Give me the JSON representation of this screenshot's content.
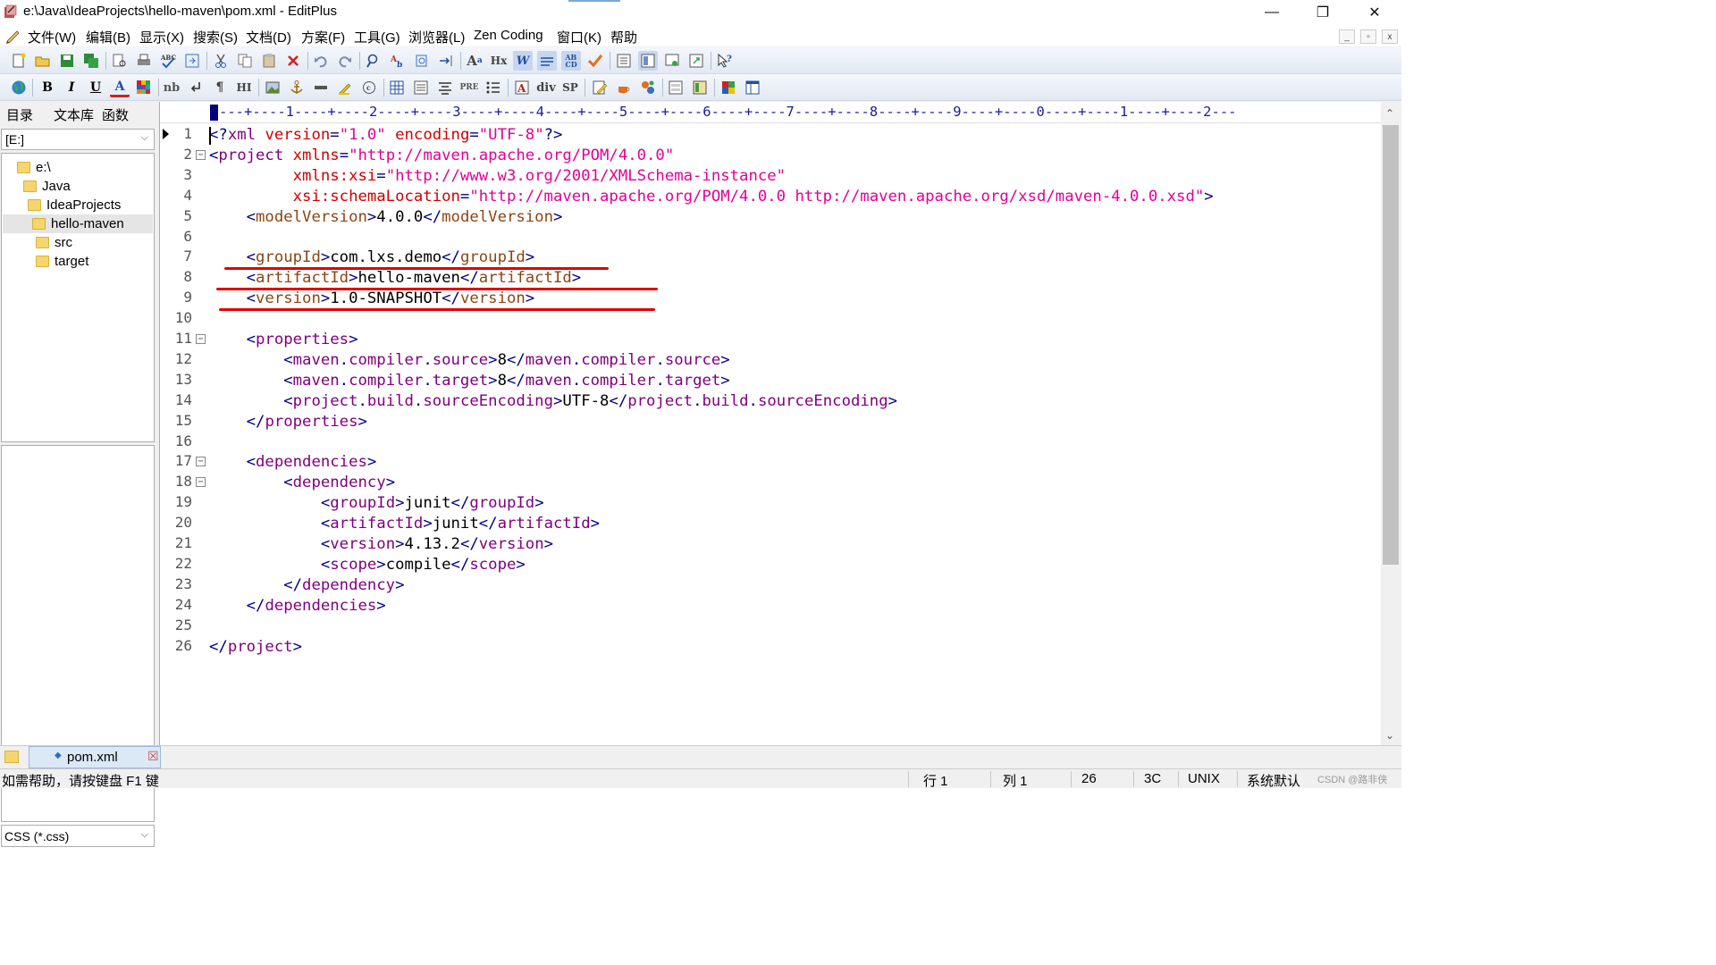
{
  "window": {
    "title": "e:\\Java\\IdeaProjects\\hello-maven\\pom.xml - EditPlus",
    "controls": {
      "minimize": "—",
      "restore": "❐",
      "close": "✕"
    }
  },
  "menu": {
    "items": [
      "文件(W)",
      "编辑(B)",
      "显示(X)",
      "搜索(S)",
      "文档(D)",
      "方案(F)",
      "工具(G)",
      "浏览器(L)",
      "Zen Coding",
      "窗口(K)",
      "帮助"
    ]
  },
  "toolbar2_text": {
    "bold": "B",
    "italic": "I",
    "underline": "U",
    "font_color": "A",
    "nbsp": "nb",
    "para": "¶",
    "heading": "HI",
    "pre": "PRE",
    "div": "div",
    "span": "SP"
  },
  "left_panel": {
    "tabs": [
      "目录",
      "文本库",
      "函数"
    ],
    "drive": "[E:]",
    "tree": [
      {
        "label": "e:\\",
        "indent": 0
      },
      {
        "label": "Java",
        "indent": 1
      },
      {
        "label": "IdeaProjects",
        "indent": 2
      },
      {
        "label": "hello-maven",
        "indent": 3,
        "selected": true
      },
      {
        "label": "src",
        "indent": 4
      },
      {
        "label": "target",
        "indent": 4
      }
    ],
    "filter": "CSS (*.css)"
  },
  "editor": {
    "ruler": "---+----1----+----2----+----3----+----4----+----5----+----6----+----7----+----8----+----9----+----0----+----1----+----2---",
    "line_numbers": [
      "1",
      "2",
      "3",
      "4",
      "5",
      "6",
      "7",
      "8",
      "9",
      "10",
      "11",
      "12",
      "13",
      "14",
      "15",
      "16",
      "17",
      "18",
      "19",
      "20",
      "21",
      "22",
      "23",
      "24",
      "25",
      "26"
    ],
    "fold_lines": [
      2,
      11,
      17,
      18
    ],
    "lines": [
      [
        [
          "t",
          "<?"
        ],
        [
          "tnm",
          "xml"
        ],
        [
          "tx",
          " "
        ],
        [
          "at",
          "version"
        ],
        [
          "t",
          "="
        ],
        [
          "av",
          "\"1.0\""
        ],
        [
          "tx",
          " "
        ],
        [
          "at",
          "encoding"
        ],
        [
          "t",
          "="
        ],
        [
          "av",
          "\"UTF-8\""
        ],
        [
          "t",
          "?>"
        ]
      ],
      [
        [
          "t",
          "<"
        ],
        [
          "tnm",
          "project"
        ],
        [
          "tx",
          " "
        ],
        [
          "at",
          "xmlns"
        ],
        [
          "t",
          "="
        ],
        [
          "av",
          "\"http://maven.apache.org/POM/4.0.0\""
        ]
      ],
      [
        [
          "tx",
          "         "
        ],
        [
          "at",
          "xmlns:xsi"
        ],
        [
          "t",
          "="
        ],
        [
          "av",
          "\"http://www.w3.org/2001/XMLSchema-instance\""
        ]
      ],
      [
        [
          "tx",
          "         "
        ],
        [
          "at",
          "xsi:schemaLocation"
        ],
        [
          "t",
          "="
        ],
        [
          "av",
          "\"http://maven.apache.org/POM/4.0.0 http://maven.apache.org/xsd/maven-4.0.0.xsd\""
        ],
        [
          "t",
          ">"
        ]
      ],
      [
        [
          "tx",
          "    "
        ],
        [
          "t",
          "<"
        ],
        [
          "tn",
          "modelVersion"
        ],
        [
          "t",
          ">"
        ],
        [
          "tx",
          "4.0.0"
        ],
        [
          "t",
          "</"
        ],
        [
          "tn",
          "modelVersion"
        ],
        [
          "t",
          ">"
        ]
      ],
      [],
      [
        [
          "tx",
          "    "
        ],
        [
          "t",
          "<"
        ],
        [
          "tn",
          "groupId"
        ],
        [
          "t",
          ">"
        ],
        [
          "tx",
          "com.lxs.demo"
        ],
        [
          "t",
          "</"
        ],
        [
          "tn",
          "groupId"
        ],
        [
          "t",
          ">"
        ]
      ],
      [
        [
          "tx",
          "    "
        ],
        [
          "t",
          "<"
        ],
        [
          "tn",
          "artifactId"
        ],
        [
          "t",
          ">"
        ],
        [
          "tx",
          "hello-maven"
        ],
        [
          "t",
          "</"
        ],
        [
          "tn",
          "artifactId"
        ],
        [
          "t",
          ">"
        ]
      ],
      [
        [
          "tx",
          "    "
        ],
        [
          "t",
          "<"
        ],
        [
          "tn",
          "version"
        ],
        [
          "t",
          ">"
        ],
        [
          "tx",
          "1.0-SNAPSHOT"
        ],
        [
          "t",
          "</"
        ],
        [
          "tn",
          "version"
        ],
        [
          "t",
          ">"
        ]
      ],
      [],
      [
        [
          "tx",
          "    "
        ],
        [
          "t",
          "<"
        ],
        [
          "tnm",
          "properties"
        ],
        [
          "t",
          ">"
        ]
      ],
      [
        [
          "tx",
          "        "
        ],
        [
          "t",
          "<"
        ],
        [
          "tnm",
          "maven"
        ],
        [
          "t",
          "."
        ],
        [
          "tnm",
          "compiler"
        ],
        [
          "t",
          "."
        ],
        [
          "tnm",
          "source"
        ],
        [
          "t",
          ">"
        ],
        [
          "tx",
          "8"
        ],
        [
          "t",
          "</"
        ],
        [
          "tnm",
          "maven"
        ],
        [
          "t",
          "."
        ],
        [
          "tnm",
          "compiler"
        ],
        [
          "t",
          "."
        ],
        [
          "tnm",
          "source"
        ],
        [
          "t",
          ">"
        ]
      ],
      [
        [
          "tx",
          "        "
        ],
        [
          "t",
          "<"
        ],
        [
          "tnm",
          "maven"
        ],
        [
          "t",
          "."
        ],
        [
          "tnm",
          "compiler"
        ],
        [
          "t",
          "."
        ],
        [
          "tnm",
          "target"
        ],
        [
          "t",
          ">"
        ],
        [
          "tx",
          "8"
        ],
        [
          "t",
          "</"
        ],
        [
          "tnm",
          "maven"
        ],
        [
          "t",
          "."
        ],
        [
          "tnm",
          "compiler"
        ],
        [
          "t",
          "."
        ],
        [
          "tnm",
          "target"
        ],
        [
          "t",
          ">"
        ]
      ],
      [
        [
          "tx",
          "        "
        ],
        [
          "t",
          "<"
        ],
        [
          "tnm",
          "project"
        ],
        [
          "t",
          "."
        ],
        [
          "tnm",
          "build"
        ],
        [
          "t",
          "."
        ],
        [
          "tnm",
          "sourceEncoding"
        ],
        [
          "t",
          ">"
        ],
        [
          "tx",
          "UTF-8"
        ],
        [
          "t",
          "</"
        ],
        [
          "tnm",
          "project"
        ],
        [
          "t",
          "."
        ],
        [
          "tnm",
          "build"
        ],
        [
          "t",
          "."
        ],
        [
          "tnm",
          "sourceEncoding"
        ],
        [
          "t",
          ">"
        ]
      ],
      [
        [
          "tx",
          "    "
        ],
        [
          "t",
          "</"
        ],
        [
          "tnm",
          "properties"
        ],
        [
          "t",
          ">"
        ]
      ],
      [],
      [
        [
          "tx",
          "    "
        ],
        [
          "t",
          "<"
        ],
        [
          "tnm",
          "dependencies"
        ],
        [
          "t",
          ">"
        ]
      ],
      [
        [
          "tx",
          "        "
        ],
        [
          "t",
          "<"
        ],
        [
          "tnm",
          "dependency"
        ],
        [
          "t",
          ">"
        ]
      ],
      [
        [
          "tx",
          "            "
        ],
        [
          "t",
          "<"
        ],
        [
          "tnm",
          "groupId"
        ],
        [
          "t",
          ">"
        ],
        [
          "tx",
          "junit"
        ],
        [
          "t",
          "</"
        ],
        [
          "tnm",
          "groupId"
        ],
        [
          "t",
          ">"
        ]
      ],
      [
        [
          "tx",
          "            "
        ],
        [
          "t",
          "<"
        ],
        [
          "tnm",
          "artifactId"
        ],
        [
          "t",
          ">"
        ],
        [
          "tx",
          "junit"
        ],
        [
          "t",
          "</"
        ],
        [
          "tnm",
          "artifactId"
        ],
        [
          "t",
          ">"
        ]
      ],
      [
        [
          "tx",
          "            "
        ],
        [
          "t",
          "<"
        ],
        [
          "tnm",
          "version"
        ],
        [
          "t",
          ">"
        ],
        [
          "tx",
          "4.13.2"
        ],
        [
          "t",
          "</"
        ],
        [
          "tnm",
          "version"
        ],
        [
          "t",
          ">"
        ]
      ],
      [
        [
          "tx",
          "            "
        ],
        [
          "t",
          "<"
        ],
        [
          "tnm",
          "scope"
        ],
        [
          "t",
          ">"
        ],
        [
          "tx",
          "compile"
        ],
        [
          "t",
          "</"
        ],
        [
          "tnm",
          "scope"
        ],
        [
          "t",
          ">"
        ]
      ],
      [
        [
          "tx",
          "        "
        ],
        [
          "t",
          "</"
        ],
        [
          "tnm",
          "dependency"
        ],
        [
          "t",
          ">"
        ]
      ],
      [
        [
          "tx",
          "    "
        ],
        [
          "t",
          "</"
        ],
        [
          "tnm",
          "dependencies"
        ],
        [
          "t",
          ">"
        ]
      ],
      [],
      [
        [
          "t",
          "</"
        ],
        [
          "tnm",
          "project"
        ],
        [
          "t",
          ">"
        ]
      ]
    ],
    "annotation_color": "#e00000"
  },
  "file_tabs": [
    {
      "label": "pom.xml",
      "close": "☒"
    }
  ],
  "status": {
    "help": "如需帮助，请按键盘 F1 键",
    "line": "行 1",
    "col": "列 1",
    "lines_total": "26",
    "hex": "3C",
    "eol": "UNIX",
    "encoding": "系统默认",
    "watermark": "CSDN @路非侠"
  }
}
